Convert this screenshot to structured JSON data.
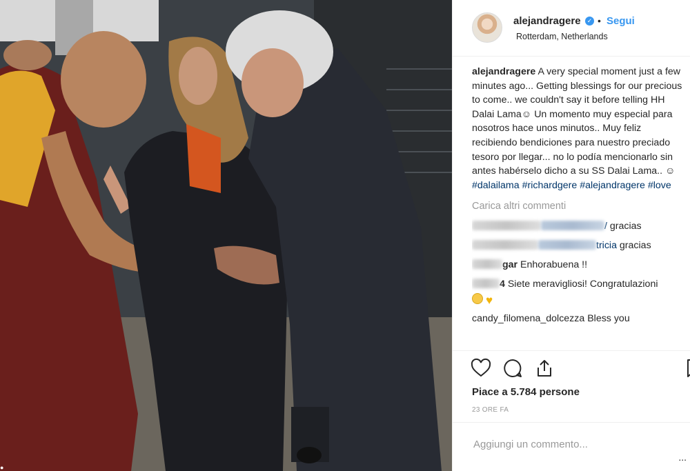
{
  "post": {
    "username": "alejandragere",
    "follow_label": "Segui",
    "dot": "•",
    "location": "Rotterdam, Netherlands",
    "caption": {
      "username": "alejandragere",
      "text": "A very special moment just a few minutes ago... Getting blessings for our precious to come.. we couldn't say it before telling HH Dalai Lama☺ Un momento muy especial para nosotros hace unos minutos.. Muy feliz recibiendo bendiciones para nuestro preciado tesoro por llegar... no lo podía mencionarlo sin antes habérselo dicho a su SS Dalai Lama.. ☺",
      "hashtags": [
        "#dalailama",
        "#richardgere",
        "#alejandragere",
        "#love"
      ]
    },
    "load_more_label": "Carica altri commenti",
    "comments": [
      {
        "mention_tail": "/",
        "text": "gracias"
      },
      {
        "mention_tail": "tricia",
        "text": "gracias"
      },
      {
        "user_tail": "gar",
        "text": "Enhorabuena !!"
      },
      {
        "user_tail": "4",
        "text": "Siete meravigliosi! Congratulazioni"
      },
      {
        "last_visible": "candy_filomena_dolcezza Bless you"
      }
    ],
    "likes_label": "Piace a 5.784 persone",
    "time_label": "23 ORE FA",
    "add_comment_placeholder": "Aggiungi un commento...",
    "more_dots": "..."
  },
  "icons": {
    "verified": "verified-badge-icon",
    "like": "heart-outline-icon",
    "comment": "speech-bubble-icon",
    "share": "share-icon",
    "save": "bookmark-icon"
  },
  "colors": {
    "link_blue": "#3897f0",
    "hashtag_blue": "#003569",
    "muted": "#999999",
    "border": "#efefef"
  }
}
